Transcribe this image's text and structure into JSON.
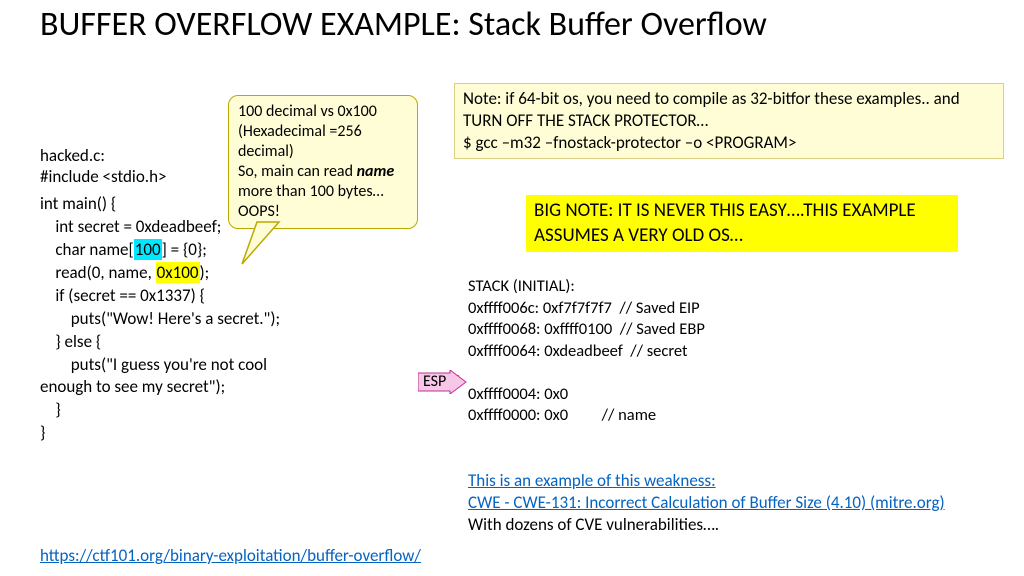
{
  "title": "BUFFER OVERFLOW EXAMPLE: Stack Buffer Overflow",
  "file": "hacked.c:",
  "include": "#include <stdio.h>",
  "code": {
    "l1": "int main() {",
    "l2": "    int secret = 0xdeadbeef;",
    "l3a": "    char name[",
    "l3_hl": "100",
    "l3b": "] = {0};",
    "l4a": "    read(0, name, ",
    "l4_hl": "0x100",
    "l4b": ");",
    "l5": "    if (secret == 0x1337) {",
    "l6": "        puts(\"Wow! Here's a secret.\");",
    "l7": "    } else {",
    "l8": "        puts(\"I guess you're not cool",
    "l9": "enough to see my secret\");",
    "l10": "    }",
    "l11": "}"
  },
  "callout": {
    "l1": "100 decimal vs 0x100 (Hexadecimal =256 decimal)",
    "l2": "So, main can read ",
    "name": "name",
    "l3": " more than 100 bytes…OOPS!"
  },
  "note1": {
    "l1": "Note: if 64-bit os, you need to compile as 32-bitfor these examples.. and TURN OFF THE STACK PROTECTOR…",
    "l2": "$ gcc –m32 –fnostack-protector –o <PROGRAM>"
  },
  "note2": "BIG NOTE: IT IS NEVER THIS EASY….THIS EXAMPLE ASSUMES A VERY OLD OS…",
  "stack": {
    "l0": "STACK (INITIAL):",
    "l1": "0xffff006c: 0xf7f7f7f7  // Saved EIP",
    "l2": "0xffff0068: 0xffff0100  // Saved EBP",
    "l3": "0xffff0064: 0xdeadbeef  // secret",
    "l4": "…",
    "l5": "0xffff0004: 0x0",
    "l6": "0xffff0000: 0x0         // name"
  },
  "esp": "ESP",
  "cwe": {
    "intro": "This is an example of this weakness:",
    "link": "CWE - CWE-131: Incorrect Calculation of Buffer Size (4.10)  (mitre.org)",
    "tail": "With dozens of CVE vulnerabilities…."
  },
  "footer": "https://ctf101.org/binary-exploitation/buffer-overflow/"
}
